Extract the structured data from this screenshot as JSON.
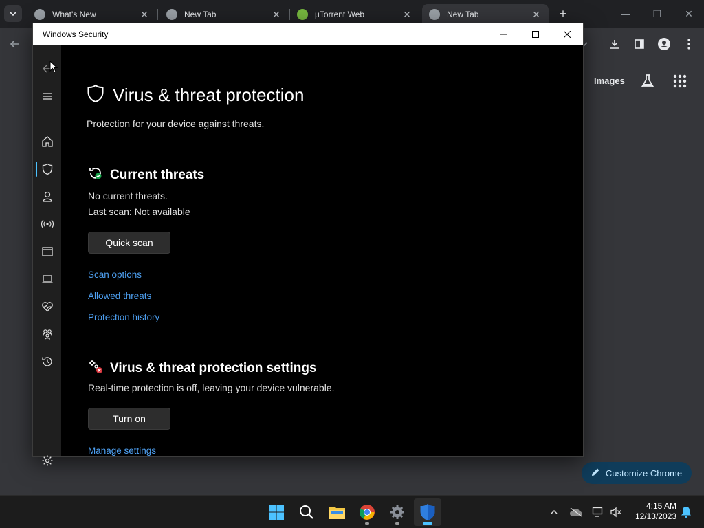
{
  "browser": {
    "tabs": [
      {
        "title": "What's New",
        "active": false
      },
      {
        "title": "New Tab",
        "active": false
      },
      {
        "title": "µTorrent Web",
        "active": false
      },
      {
        "title": "New Tab",
        "active": true
      }
    ],
    "toolbar": {
      "images_link": "Images"
    },
    "customize_label": "Customize Chrome"
  },
  "window": {
    "title": "Windows Security"
  },
  "nav": {
    "items": [
      "back-icon",
      "menu-icon",
      "home-icon",
      "shield-icon",
      "account-icon",
      "firewall-icon",
      "app-browser-icon",
      "device-security-icon",
      "health-icon",
      "family-icon",
      "history-icon",
      "settings-icon"
    ],
    "active": "shield-icon"
  },
  "page": {
    "title": "Virus & threat protection",
    "subtitle": "Protection for your device against threats."
  },
  "current_threats": {
    "heading": "Current threats",
    "status": "No current threats.",
    "last_scan": "Last scan: Not available",
    "button": "Quick scan",
    "links": [
      "Scan options",
      "Allowed threats",
      "Protection history"
    ]
  },
  "settings_section": {
    "heading": "Virus & threat protection settings",
    "status": "Real-time protection is off, leaving your device vulnerable.",
    "button": "Turn on",
    "link": "Manage settings"
  },
  "taskbar": {
    "time": "4:15 AM",
    "date": "12/13/2023",
    "apps": [
      "start-icon",
      "search-icon",
      "file-explorer-icon",
      "chrome-icon",
      "settings-icon",
      "windows-security-icon"
    ]
  },
  "colors": {
    "accent": "#4cc2ff",
    "link": "#4ea1f3",
    "window_bg": "#000000",
    "nav_bg": "#1f1f1f"
  }
}
